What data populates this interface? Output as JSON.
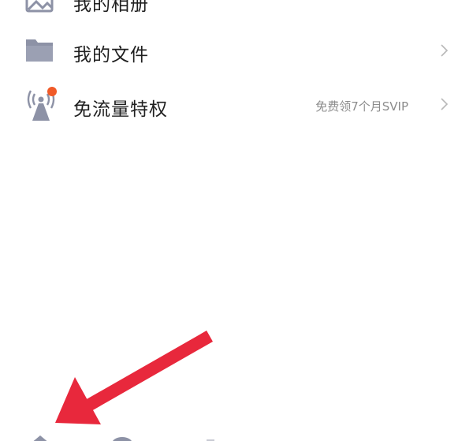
{
  "menu": {
    "items": [
      {
        "label": "我的相册",
        "hint": "",
        "icon": "photo-album-icon"
      },
      {
        "label": "我的文件",
        "hint": "",
        "icon": "folder-icon"
      },
      {
        "label": "免流量特权",
        "hint": "免费领7个月SVIP",
        "icon": "signal-tower-icon"
      }
    ]
  },
  "colors": {
    "icon_gray": "#8d92a6",
    "chevron": "#b8b8b8",
    "notification_dot": "#f05a28",
    "annotation_arrow": "#e8283c"
  },
  "tabbar": {
    "icons": [
      "home-icon",
      "profile-icon"
    ]
  }
}
